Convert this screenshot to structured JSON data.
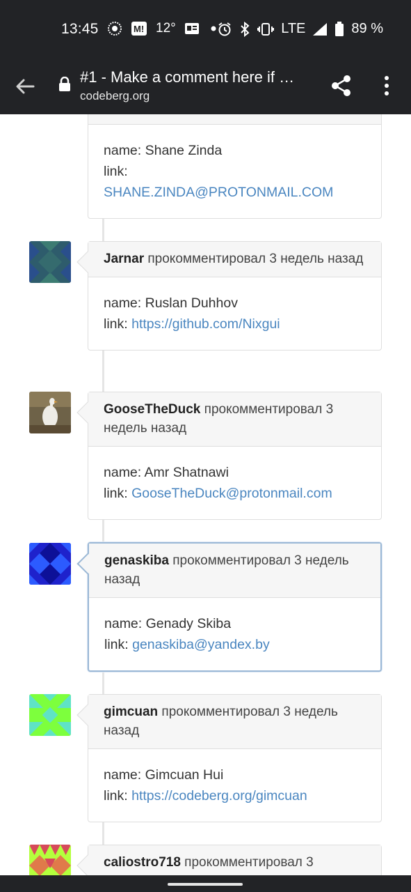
{
  "status_bar": {
    "time": "13:45",
    "temperature": "12°",
    "network": "LTE",
    "battery": "89 %",
    "icons": [
      "settings-icon",
      "m-app-icon",
      "weather-icon",
      "news-icon",
      "dot-icon",
      "alarm-icon",
      "bluetooth-icon",
      "vibrate-icon",
      "signal-icon",
      "battery-icon"
    ]
  },
  "toolbar": {
    "title": "#1 - Make a comment here if …",
    "url": "codeberg.org",
    "icons": [
      "back-arrow-icon",
      "lock-icon",
      "share-icon",
      "more-vert-icon"
    ]
  },
  "comments": [
    {
      "header": null,
      "name_line": "name: Shane Zinda",
      "link_label": "link:",
      "link": "SHANE.ZINDA@PROTONMAIL.COM"
    },
    {
      "user": "Jarnar",
      "action": " прокомментировал 3 недель назад",
      "name_line": "name: Ruslan Duhhov",
      "link_label": "link: ",
      "link": "https://github.com/Nixgui",
      "avatar_colors": [
        "#2d5b6b",
        "#3b7a72",
        "#1f4a8a"
      ]
    },
    {
      "user": "GooseTheDuck",
      "action": " прокомментировал 3 недель назад",
      "name_line": "name: Amr Shatnawi",
      "link_label": "link: ",
      "link": "GooseTheDuck@protonmail.com",
      "avatar_colors": [
        "#7a6a4a",
        "#e8e6e0",
        "#5a4a32"
      ]
    },
    {
      "user": "genaskiba",
      "action": " прокомментировал 3 недель назад",
      "name_line": "name: Genady Skiba",
      "link_label": "link: ",
      "link": "genaskiba@yandex.by",
      "avatar_colors": [
        "#1d20c8",
        "#2b55ff",
        "#0c0f9a"
      ]
    },
    {
      "user": "gimcuan",
      "action": " прокомментировал 3 недель назад",
      "name_line": "name: Gimcuan Hui",
      "link_label": "link: ",
      "link": "https://codeberg.org/gimcuan",
      "avatar_colors": [
        "#7dff3d",
        "#5fe0c8",
        "#3ad36e"
      ]
    },
    {
      "user": "caliostro718",
      "action": " прокомментировал 3",
      "avatar_colors": [
        "#b4ff3d",
        "#d64a5a",
        "#e07a4a"
      ]
    }
  ],
  "colors": {
    "chrome": "#222326",
    "link": "#4a86c0",
    "active_border": "#9bb8d6"
  }
}
